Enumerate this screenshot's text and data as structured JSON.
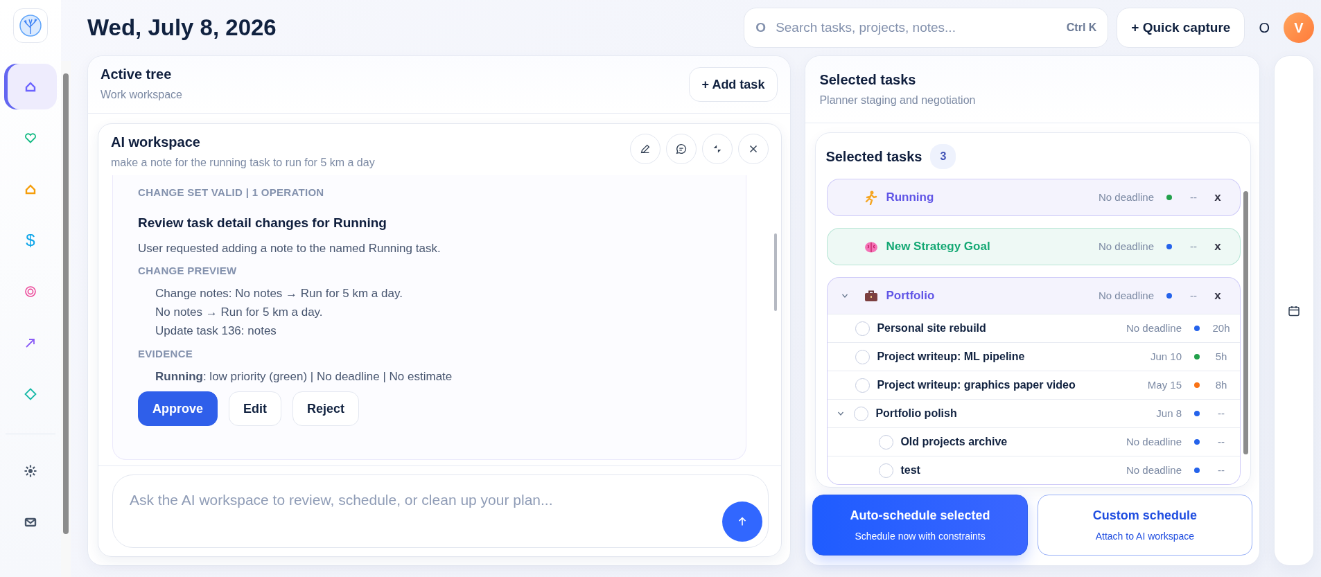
{
  "sidebar": {
    "items": [
      {
        "kind": "home",
        "color": "#6c63ff",
        "selected": true
      },
      {
        "kind": "heart",
        "color": "#10b981",
        "selected": false
      },
      {
        "kind": "home",
        "color": "#f59e0b",
        "selected": false
      },
      {
        "kind": "text",
        "glyph": "$",
        "color": "#0ea5e9",
        "selected": false
      },
      {
        "kind": "target",
        "color": "#ec4899",
        "selected": false
      },
      {
        "kind": "arrow",
        "color": "#8b5cf6",
        "selected": false
      },
      {
        "kind": "diamond",
        "color": "#14b8a6",
        "selected": false
      }
    ],
    "bottom_items": [
      {
        "kind": "sun",
        "color": "#475569",
        "selected": false
      },
      {
        "kind": "mail",
        "color": "#475569",
        "selected": false
      }
    ]
  },
  "header": {
    "date": "Wed, July 8, 2026",
    "search": {
      "glyph": "O",
      "placeholder": "Search tasks, projects, notes...",
      "shortcut": "Ctrl K"
    },
    "quick_capture": "+ Quick capture",
    "status_glyph": "O",
    "avatar": "V"
  },
  "active_tree": {
    "title": "Active tree",
    "subtitle": "Work workspace",
    "add_button": "+ Add task",
    "ai_workspace": {
      "title": "AI workspace",
      "prompt": "make a note for the running task to run for 5 km a day",
      "proposal": {
        "status": "CHANGE SET VALID | 1 OPERATION",
        "title": "Review task detail changes for Running",
        "summary": "User requested adding a note to the named Running task.",
        "sections": [
          {
            "heading": "CHANGE PREVIEW",
            "lines": [
              "Change notes: No notes → Run for 5 km a day.",
              "No notes → Run for 5 km a day.",
              "Update task 136: notes"
            ]
          },
          {
            "heading": "EVIDENCE",
            "lines": [
              "**Running**: low priority (green) | No deadline | No estimate"
            ]
          }
        ],
        "actions": [
          {
            "label": "Approve",
            "kind": "primary"
          },
          {
            "label": "Edit",
            "kind": "secondary"
          },
          {
            "label": "Reject",
            "kind": "secondary"
          }
        ]
      },
      "input": {
        "placeholder": "Ask the AI workspace to review, schedule, or clean up your plan..."
      }
    }
  },
  "planner": {
    "title": "Selected tasks",
    "subtitle": "Planner staging and negotiation",
    "card": {
      "title": "Selected tasks",
      "count": "3",
      "items": [
        {
          "name": "Running",
          "color": "#6055e6",
          "deadline": "No deadline",
          "priority": {
            "color": "#22a04b"
          },
          "estimate": "--",
          "remove": "x"
        },
        {
          "name": "New Strategy Goal",
          "color": "#13a873",
          "deadline": "No deadline",
          "priority": {
            "color": "#2563eb"
          },
          "estimate": "--",
          "remove": "x"
        },
        {
          "name": "Portfolio",
          "color": "#6055e6",
          "expanded": true,
          "deadline": "No deadline",
          "priority": {
            "color": "#2563eb"
          },
          "estimate": "--",
          "remove": "x",
          "children": [
            {
              "name": "Personal site rebuild",
              "checked": false,
              "deadline": "No deadline",
              "color": "#2563eb",
              "estimate": "20h"
            },
            {
              "name": "Project writeup: ML pipeline",
              "checked": false,
              "deadline": "Jun 10",
              "color": "#22a04b",
              "estimate": "5h"
            },
            {
              "name": "Project writeup: graphics paper video",
              "checked": false,
              "deadline": "May 15",
              "color": "#f97316",
              "estimate": "8h"
            },
            {
              "name": "Portfolio polish",
              "checked": false,
              "expanded": true,
              "deadline": "Jun 8",
              "color": "#2563eb",
              "estimate": "--",
              "children": [
                {
                  "name": "Old projects archive",
                  "checked": false,
                  "deadline": "No deadline",
                  "color": "#2563eb",
                  "estimate": "--"
                },
                {
                  "name": "test",
                  "checked": false,
                  "deadline": "No deadline",
                  "color": "#2563eb",
                  "estimate": "--"
                }
              ]
            }
          ]
        }
      ]
    },
    "actions": [
      {
        "kind": "primary",
        "title": "Auto-schedule selected",
        "subtitle": "Schedule now with constraints"
      },
      {
        "kind": "outline",
        "title": "Custom schedule",
        "subtitle": "Attach to AI workspace"
      }
    ]
  }
}
